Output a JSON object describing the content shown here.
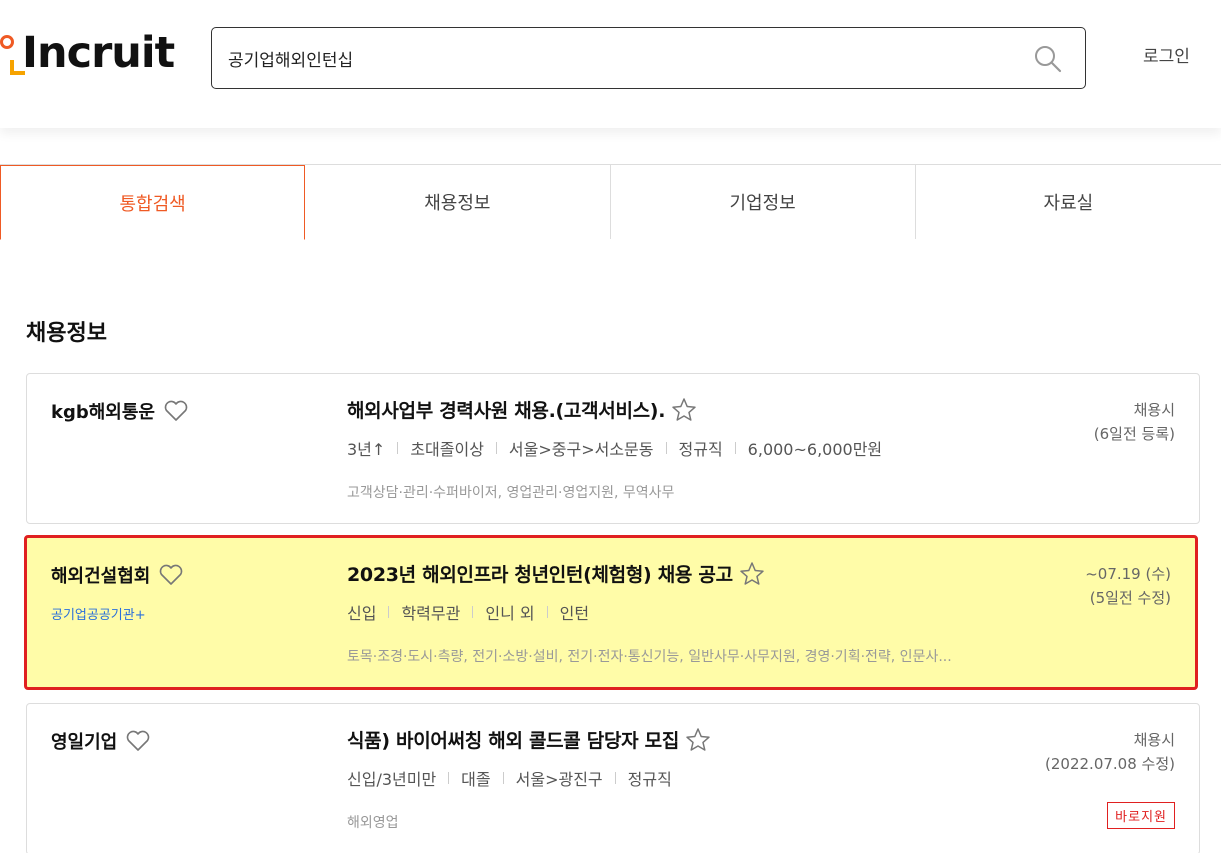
{
  "header": {
    "logo_text": "Incruit",
    "search_value": "공기업해외인턴십",
    "login_label": "로그인"
  },
  "tabs": [
    {
      "label": "통합검색",
      "active": true
    },
    {
      "label": "채용정보",
      "active": false
    },
    {
      "label": "기업정보",
      "active": false
    },
    {
      "label": "자료실",
      "active": false
    }
  ],
  "section_title": "채용정보",
  "jobs": [
    {
      "company": "kgb해외통운",
      "badge": "",
      "title": "해외사업부 경력사원 채용.(고객서비스).",
      "conditions": [
        "3년↑",
        "초대졸이상",
        "서울>중구>서소문동",
        "정규직",
        "6,000~6,000만원"
      ],
      "tags": "고객상담·관리·수퍼바이저,  영업관리·영업지원,  무역사무",
      "meta_line1": "채용시",
      "meta_line2": "(6일전 등록)",
      "apply_label": ""
    },
    {
      "company": "해외건설협회",
      "badge": "공기업공공기관+",
      "title": "2023년 해외인프라 청년인턴(체험형) 채용 공고",
      "conditions": [
        "신입",
        "학력무관",
        "인니 외",
        "인턴"
      ],
      "tags": "토목·조경·도시·측량,  전기·소방·설비,  전기·전자·통신기능,  일반사무·사무지원,  경영·기획·전략,  인문사...",
      "meta_line1": "~07.19 (수)",
      "meta_line2": "(5일전 수정)",
      "apply_label": ""
    },
    {
      "company": "영일기업",
      "badge": "",
      "title": "식품) 바이어써칭 해외 콜드콜 담당자 모집",
      "conditions": [
        "신입/3년미만",
        "대졸",
        "서울>광진구",
        "정규직"
      ],
      "tags": "해외영업",
      "meta_line1": "채용시",
      "meta_line2": "(2022.07.08 수정)",
      "apply_label": "바로지원"
    }
  ],
  "colors": {
    "brand_orange": "#ef5a24",
    "highlight_bg": "#fffca8",
    "highlight_border": "#e02020",
    "link_blue": "#2a6fdb"
  }
}
